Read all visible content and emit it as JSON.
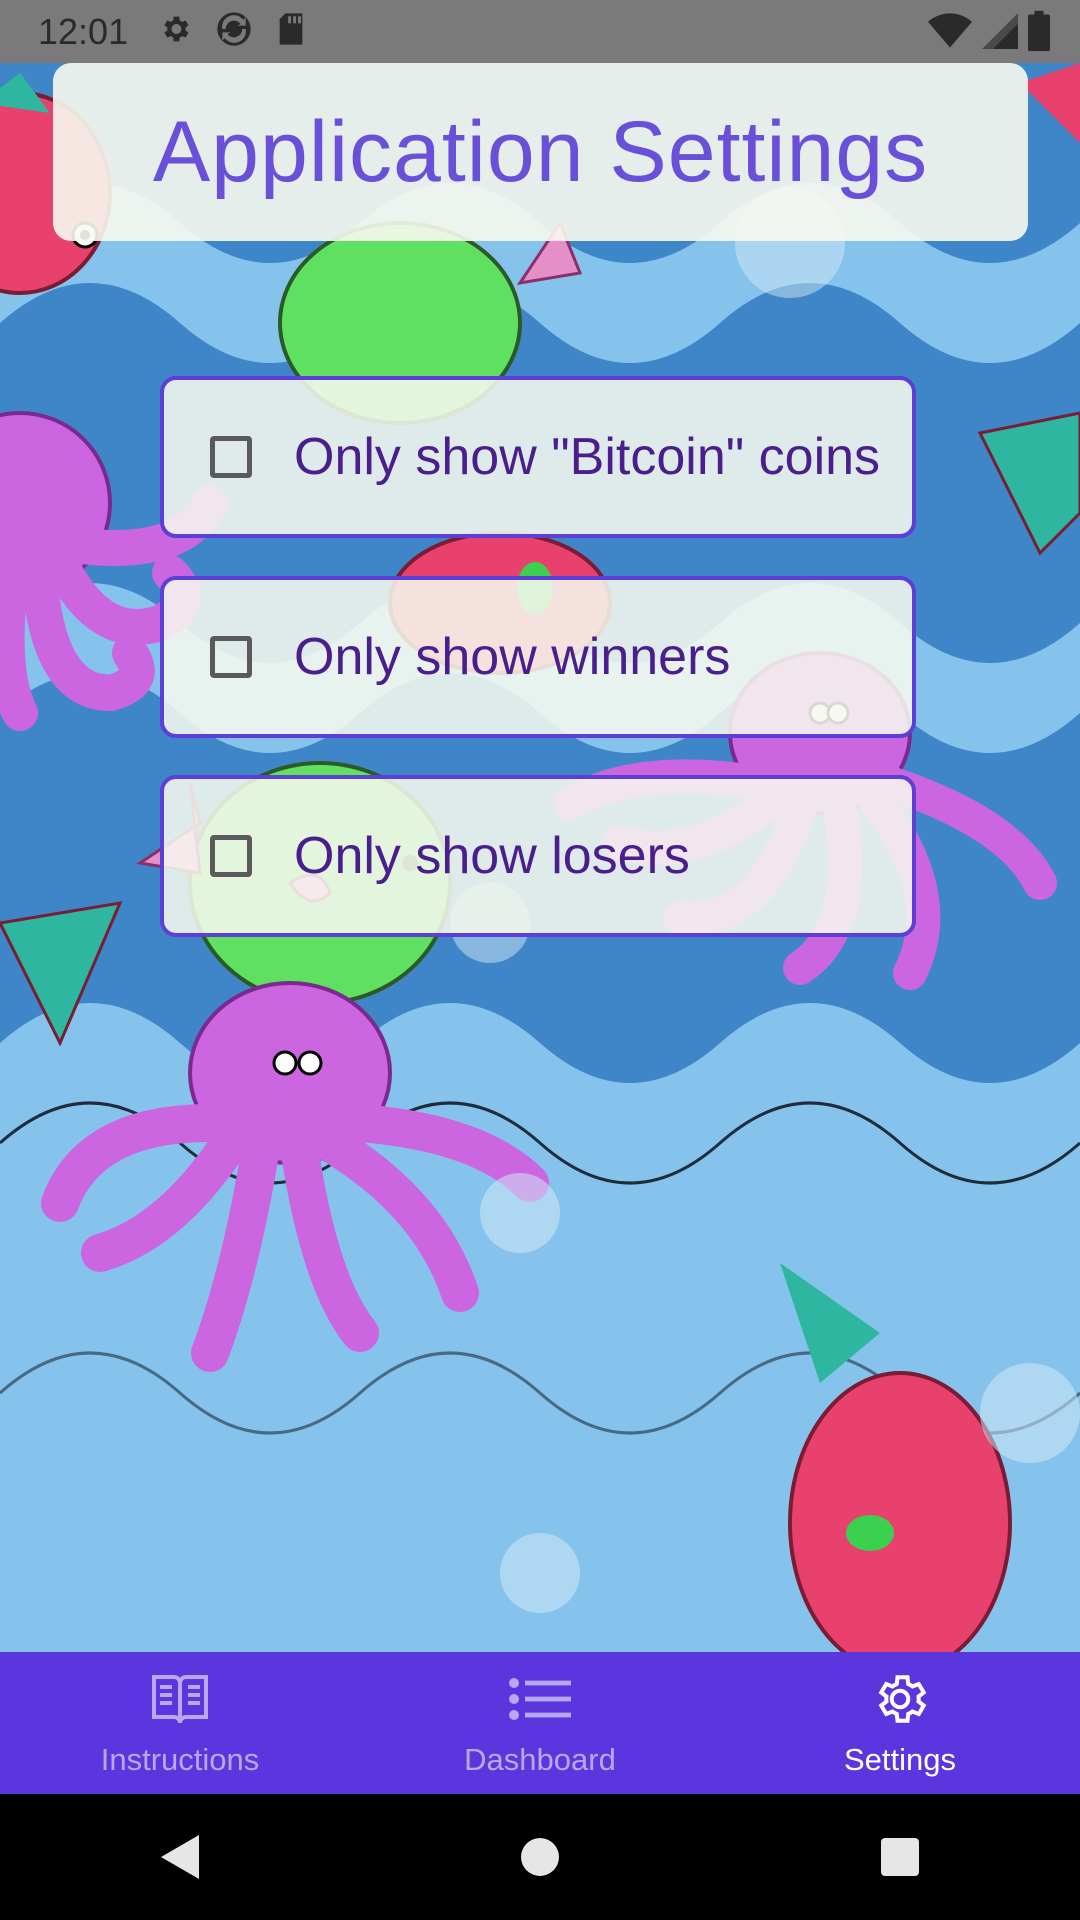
{
  "status_bar": {
    "time": "12:01",
    "icons_left": [
      "gear-icon",
      "sync-icon",
      "sd-card-icon"
    ],
    "icons_right": [
      "wifi-icon",
      "signal-icon",
      "battery-icon"
    ]
  },
  "header": {
    "title": "Application Settings"
  },
  "options": [
    {
      "label": "Only show \"Bitcoin\" coins",
      "checked": false
    },
    {
      "label": "Only show winners",
      "checked": false
    },
    {
      "label": "Only show losers",
      "checked": false
    }
  ],
  "bottom_nav": {
    "items": [
      {
        "label": "Instructions",
        "icon": "book-icon",
        "active": false
      },
      {
        "label": "Dashboard",
        "icon": "list-icon",
        "active": false
      },
      {
        "label": "Settings",
        "icon": "gear-icon",
        "active": true
      }
    ]
  },
  "system_nav": {
    "buttons": [
      "back-icon",
      "home-icon",
      "recents-icon"
    ]
  },
  "colors": {
    "accent": "#5b36df",
    "title": "#6a50d8",
    "option_text": "#4a1e8c",
    "water_dark": "#3f86c9",
    "water_light": "#86c3ec",
    "octopus": "#cc66e0",
    "pufferfish": "#5fe060",
    "fish": "#e8416e"
  }
}
